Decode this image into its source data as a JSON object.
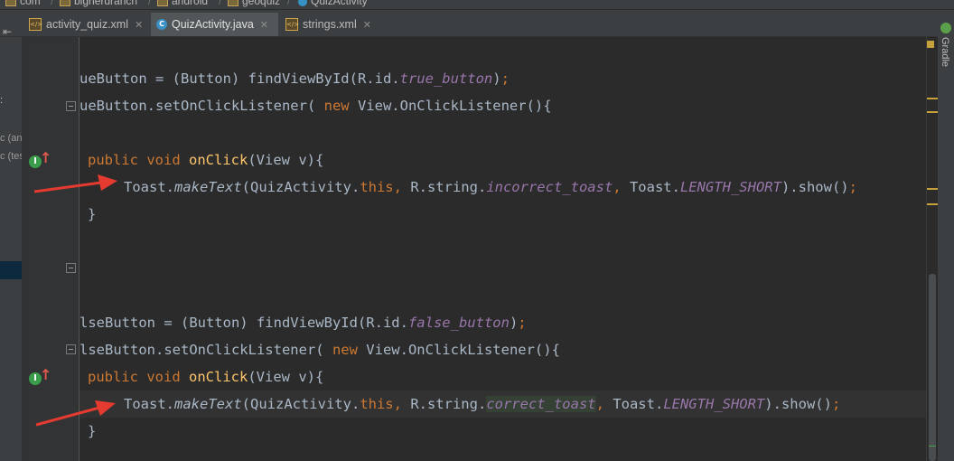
{
  "breadcrumb": {
    "items": [
      "com",
      "bignerdranch",
      "android",
      "geoquiz",
      "QuizActivity"
    ]
  },
  "tabs": [
    {
      "label": "activity_quiz.xml",
      "type": "xml",
      "active": false
    },
    {
      "label": "QuizActivity.java",
      "type": "java",
      "active": true
    },
    {
      "label": "strings.xml",
      "type": "xml",
      "active": false
    }
  ],
  "left_panel": {
    "item1": "c (an",
    "item2": "c (tes"
  },
  "right_panel": {
    "gradle_label": "Gradle"
  },
  "code": {
    "line1": {
      "a": "ueButton = (Button) findViewById(R.id.",
      "b": "true_button",
      "c": ")",
      "d": ";"
    },
    "line2": {
      "a": "ueButton.setOnClickListener( ",
      "b": "new",
      "c": " View.OnClickListener(){"
    },
    "line3": {
      "a": "public",
      "b": "void",
      "c": "onClick",
      "d": "(View v){"
    },
    "line4": {
      "a": "Toast.",
      "b": "makeText",
      "c": "(QuizActivity.",
      "d": "this",
      "e": ",",
      "f": " R.string.",
      "g": "incorrect_toast",
      "h": ",",
      "i": " Toast.",
      "j": "LENGTH_SHORT",
      "k": ").show()",
      "l": ";"
    },
    "line5": "}",
    "line6": {
      "a": "lseButton = (Button) findViewById(R.id.",
      "b": "false_button",
      "c": ")",
      "d": ";"
    },
    "line7": {
      "a": "lseButton.setOnClickListener( ",
      "b": "new",
      "c": " View.OnClickListener(){"
    },
    "line8": {
      "a": "public",
      "b": "void",
      "c": "onClick",
      "d": "(View v){"
    },
    "line9": {
      "a": "Toast.",
      "b": "makeText",
      "c": "(QuizActivity.",
      "d": "this",
      "e": ",",
      "f": " R.string.",
      "g": "correct_toast",
      "h": ",",
      "i": " Toast.",
      "j": "LENGTH_SHORT",
      "k": ").show()",
      "l": ";"
    },
    "line10": "}"
  },
  "gutter": {
    "impl_icon_glyph": "I",
    "impl_arrow_glyph": "↑"
  },
  "colors": {
    "editor_bg": "#2b2b2b",
    "keyword": "#cc7832",
    "method": "#ffc66d",
    "field_italic": "#9876aa",
    "plain": "#a9b7c6",
    "annotation_arrow": "#e53a2f"
  }
}
